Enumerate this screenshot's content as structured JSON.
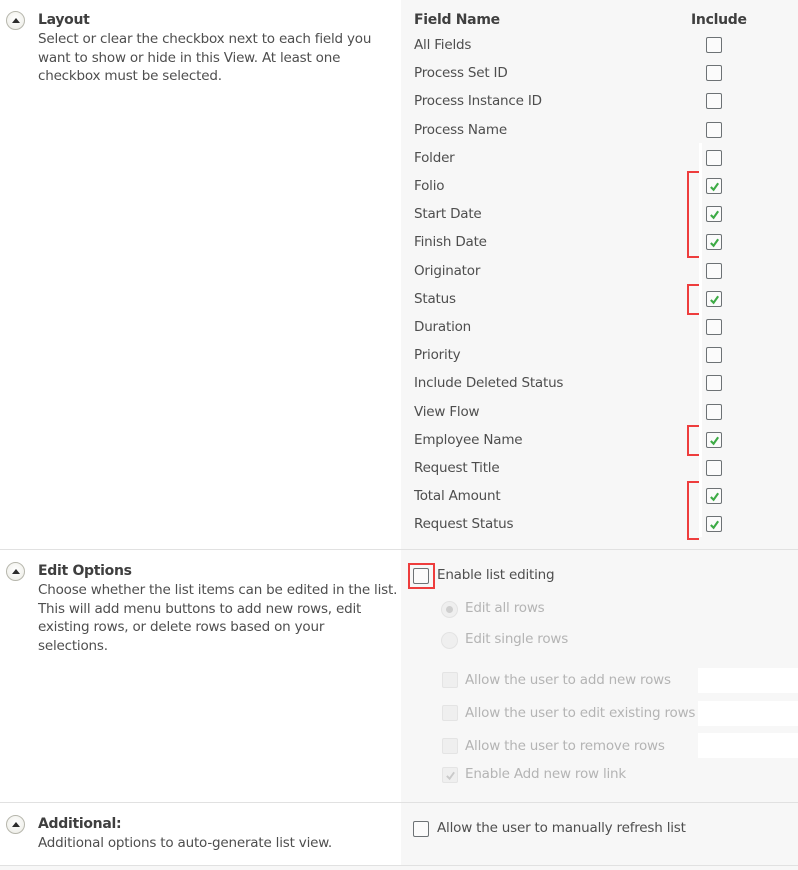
{
  "layout": {
    "title": "Layout",
    "description": "Select or clear the checkbox next to each field you want to show or hide in this View. At least one checkbox must be selected.",
    "toggle_icon": "collapse-up-icon",
    "columns": {
      "field_name": "Field Name",
      "include": "Include"
    },
    "fields": [
      {
        "name": "All Fields",
        "include": false
      },
      {
        "name": "Process Set ID",
        "include": false
      },
      {
        "name": "Process Instance ID",
        "include": false
      },
      {
        "name": "Process Name",
        "include": false
      },
      {
        "name": "Folder",
        "include": false
      },
      {
        "name": "Folio",
        "include": true
      },
      {
        "name": "Start Date",
        "include": true
      },
      {
        "name": "Finish Date",
        "include": true
      },
      {
        "name": "Originator",
        "include": false
      },
      {
        "name": "Status",
        "include": true
      },
      {
        "name": "Duration",
        "include": false
      },
      {
        "name": "Priority",
        "include": false
      },
      {
        "name": "Include Deleted Status",
        "include": false
      },
      {
        "name": "View Flow",
        "include": false
      },
      {
        "name": "Employee Name",
        "include": true
      },
      {
        "name": "Request Title",
        "include": false
      },
      {
        "name": "Total Amount",
        "include": true
      },
      {
        "name": "Request Status",
        "include": true
      }
    ],
    "highlight_color": "#ee3d3d",
    "check_color": "#3dab45"
  },
  "edit_options": {
    "title": "Edit Options",
    "description": "Choose whether the list items can be edited in the list. This will add menu buttons to add new rows, edit existing rows, or delete rows based on your selections.",
    "enable_list_editing": {
      "label": "Enable list editing",
      "checked": false
    },
    "radios": [
      {
        "label": "Edit all rows",
        "selected": true,
        "disabled": true
      },
      {
        "label": "Edit single rows",
        "selected": false,
        "disabled": true
      }
    ],
    "checkboxes": [
      {
        "label": "Allow the user to add new rows",
        "checked": false,
        "disabled": true,
        "input_value": ""
      },
      {
        "label": "Allow the user to edit existing rows",
        "checked": false,
        "disabled": true,
        "input_value": ""
      },
      {
        "label": "Allow the user to remove rows",
        "checked": false,
        "disabled": true,
        "input_value": ""
      },
      {
        "label": "Enable Add new row link",
        "checked": true,
        "disabled": true
      }
    ]
  },
  "additional": {
    "title": "Additional:",
    "description": "Additional options to auto-generate list view.",
    "refresh": {
      "label": "Allow the user to manually refresh list",
      "checked": false
    }
  }
}
